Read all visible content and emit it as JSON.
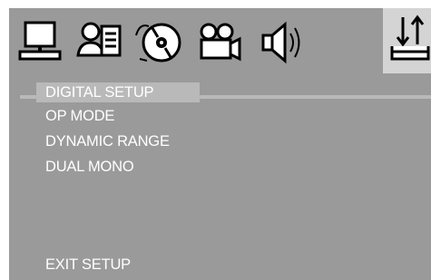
{
  "toolbar": {
    "tabs": [
      {
        "icon": "monitor-icon",
        "active": false
      },
      {
        "icon": "language-icon",
        "active": false
      },
      {
        "icon": "disc-icon",
        "active": false
      },
      {
        "icon": "camera-icon",
        "active": false
      },
      {
        "icon": "speaker-icon",
        "active": false
      },
      {
        "icon": "digital-arrows-icon",
        "active": true
      }
    ]
  },
  "menu": {
    "header": "DIGITAL SETUP",
    "items": [
      "OP MODE",
      "DYNAMIC RANGE",
      "DUAL MONO"
    ],
    "exit": "EXIT SETUP"
  },
  "colors": {
    "background": "#9a9a9a",
    "highlight": "#b9b9b9",
    "active_tab": "#d4d4d4",
    "text": "#ffffff"
  }
}
